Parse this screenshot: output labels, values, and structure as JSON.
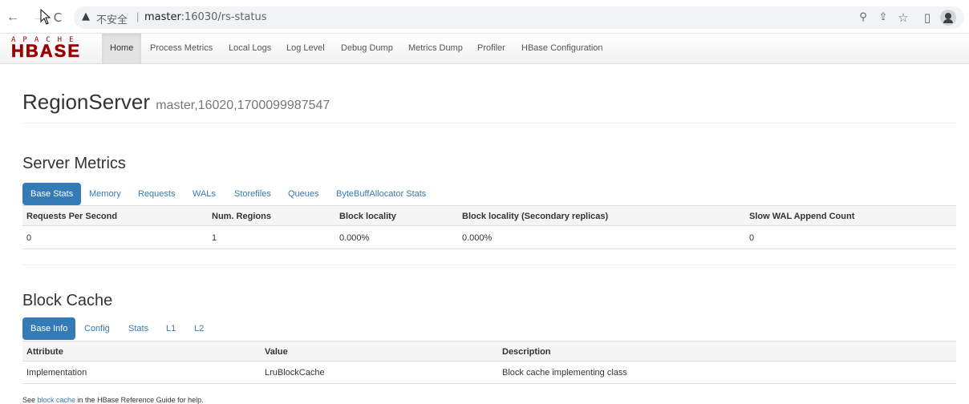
{
  "browser": {
    "back_icon": "←",
    "forward_icon": "→",
    "reload_icon": "C",
    "warning_icon": "▲",
    "insecure_label": "不安全",
    "separator": "|",
    "url_host": "master",
    "url_path": ":16030/rs-status",
    "zoom_icon": "⚲",
    "share_icon": "⇪",
    "star_icon": "☆",
    "sidepanel_icon": "▯"
  },
  "logo": {
    "apache": "APACHE",
    "hbase": "HBASE"
  },
  "navbar": {
    "items": [
      "Home",
      "Process Metrics",
      "Local Logs",
      "Log Level",
      "Debug Dump",
      "Metrics Dump",
      "Profiler",
      "HBase Configuration"
    ],
    "active": "Home"
  },
  "page": {
    "title": "RegionServer",
    "subtitle": "master,16020,1700099987547"
  },
  "server_metrics": {
    "title": "Server Metrics",
    "tabs": [
      "Base Stats",
      "Memory",
      "Requests",
      "WALs",
      "Storefiles",
      "Queues",
      "ByteBuffAllocator Stats"
    ],
    "active_tab": "Base Stats",
    "columns": [
      "Requests Per Second",
      "Num. Regions",
      "Block locality",
      "Block locality (Secondary replicas)",
      "Slow WAL Append Count"
    ],
    "rows": [
      [
        "0",
        "1",
        "0.000%",
        "0.000%",
        "0"
      ]
    ]
  },
  "block_cache": {
    "title": "Block Cache",
    "tabs": [
      "Base Info",
      "Config",
      "Stats",
      "L1",
      "L2"
    ],
    "active_tab": "Base Info",
    "columns": [
      "Attribute",
      "Value",
      "Description"
    ],
    "rows": [
      [
        "Implementation",
        "LruBlockCache",
        "Block cache implementing class"
      ]
    ]
  },
  "footnote": {
    "prefix": "See ",
    "link": "block cache",
    "suffix": " in the HBase Reference Guide for help."
  },
  "colors": {
    "accent": "#337ab7",
    "logo": "#9a0000"
  }
}
